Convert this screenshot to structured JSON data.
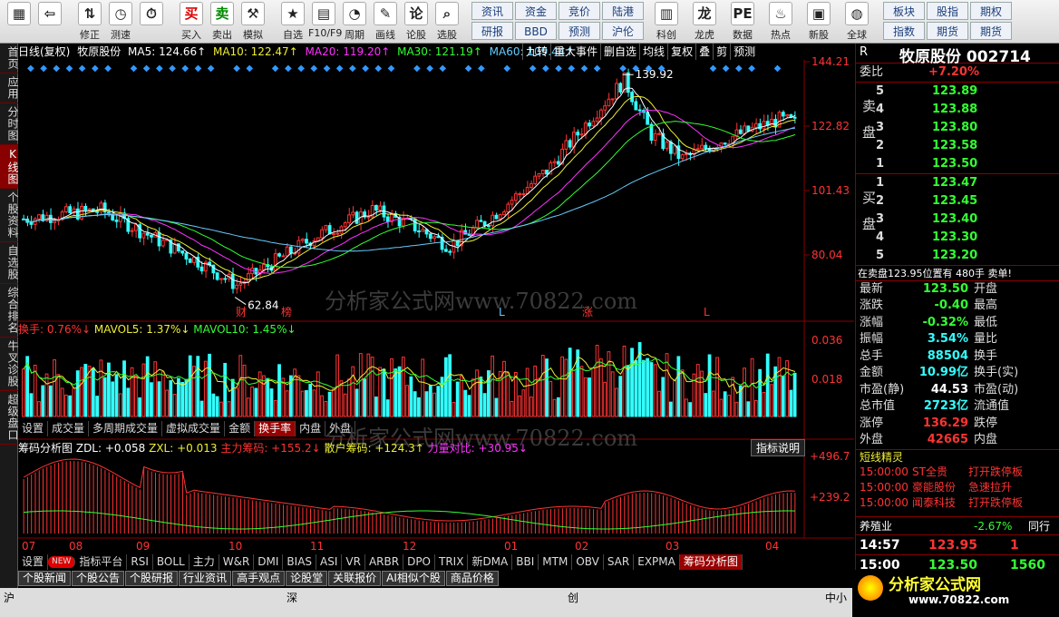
{
  "toolbar": {
    "buttons": [
      {
        "label": "",
        "icon": "grid-icon"
      },
      {
        "label": "",
        "icon": "back-arrow-icon"
      },
      {
        "label": "修正",
        "icon": "up-down-icon"
      },
      {
        "label": "测速",
        "icon": "timer-icon"
      },
      {
        "label": "",
        "icon": "clock-icon"
      },
      {
        "label": "买入",
        "icon": "buy-icon"
      },
      {
        "label": "卖出",
        "icon": "sell-icon"
      },
      {
        "label": "模拟",
        "icon": "gavel-icon"
      },
      {
        "label": "自选",
        "icon": "star-icon"
      },
      {
        "label": "F10/F9",
        "icon": "f10-icon"
      },
      {
        "label": "周期",
        "icon": "period-icon"
      },
      {
        "label": "画线",
        "icon": "pencil-icon"
      },
      {
        "label": "论股",
        "icon": "discuss-icon"
      },
      {
        "label": "选股",
        "icon": "magnifier-icon"
      }
    ],
    "pairs": [
      [
        "资讯",
        "研报"
      ],
      [
        "资金",
        "BBD"
      ],
      [
        "竞价",
        "预测"
      ],
      [
        "陆港",
        "沪伦"
      ]
    ],
    "buttons2": [
      {
        "label": "科创",
        "icon": "chart-icon"
      },
      {
        "label": "龙虎",
        "icon": "dragon-icon"
      },
      {
        "label": "数据",
        "icon": "pe-icon"
      },
      {
        "label": "热点",
        "icon": "fire-icon"
      },
      {
        "label": "新股",
        "icon": "calendar-icon"
      },
      {
        "label": "全球",
        "icon": "globe-icon"
      }
    ],
    "pairs2": [
      [
        "板块",
        "指数"
      ],
      [
        "股指",
        "期货"
      ],
      [
        "期权",
        "期货"
      ]
    ]
  },
  "leftnav": [
    "首页",
    "应用",
    "分时图",
    "K线图",
    "个股资料",
    "自选股",
    "综合排名",
    "牛叉诊股",
    "超级盘口"
  ],
  "leftnav_active": 3,
  "top_info": {
    "period": "日线(复权)",
    "name": "牧原股份",
    "ma5": "MA5: 124.66↑",
    "ma10": "MA10: 122.47↑",
    "ma20": "MA20: 119.20↑",
    "ma30": "MA30: 121.19↑",
    "ma60": "MA60: 109.44↑",
    "tabs": [
      "九转",
      "重大事件",
      "删自选",
      "均线",
      "复权",
      "叠",
      "剪",
      "预测"
    ]
  },
  "price_axis": [
    "144.21",
    "122.82",
    "101.43",
    "80.04"
  ],
  "price_markers": {
    "high": "139.92",
    "low": "62.84"
  },
  "event_markers": [
    "财",
    "榜",
    "L",
    "涨",
    "L"
  ],
  "volume_header": {
    "label": "换手: 0.76%↓",
    "mavol5": "MAVOL5: 1.37%↓",
    "mavol10": "MAVOL10: 1.45%↓"
  },
  "volume_axis": [
    "0.036",
    "0.018"
  ],
  "vol_tabs": [
    "设置",
    "成交量",
    "多周期成交量",
    "虚拟成交量",
    "金额",
    "换手率",
    "内盘",
    "外盘"
  ],
  "vol_tabs_active": 5,
  "chip_header": {
    "title": "筹码分析图",
    "zdl": "ZDL: +0.058",
    "zxl": "ZXL: +0.013",
    "main": "主力筹码: +155.2↓",
    "retail": "散户筹码: +124.3↑",
    "ratio": "力量对比: +30.95↓",
    "help": "指标说明"
  },
  "chip_axis": [
    "+496.7",
    "+239.2"
  ],
  "months": [
    "07",
    "08",
    "09",
    "10",
    "11",
    "12",
    "01",
    "02",
    "03",
    "04"
  ],
  "indicator_tabs": [
    "设置",
    "NEW",
    "指标平台",
    "RSI",
    "BOLL",
    "主力",
    "W&R",
    "DMI",
    "BIAS",
    "ASI",
    "VR",
    "ARBR",
    "DPO",
    "TRIX",
    "新DMA",
    "BBI",
    "MTM",
    "OBV",
    "SAR",
    "EXPMA",
    "筹码分析图"
  ],
  "indicator_active": 20,
  "news_tabs": [
    "个股新闻",
    "个股公告",
    "个股研报",
    "行业资讯",
    "高手观点",
    "论股堂",
    "关联报价",
    "AI相似个股",
    "商品价格"
  ],
  "watermark": "分析家公式网www.70822.com",
  "quote": {
    "r_label": "R",
    "title": "牧原股份 002714",
    "webi": {
      "label": "委比",
      "value": "+7.20%"
    },
    "sell_label": "卖盘",
    "buy_label": "买盘",
    "asks": [
      {
        "level": "5",
        "price": "123.89"
      },
      {
        "level": "4",
        "price": "123.88"
      },
      {
        "level": "3",
        "price": "123.80"
      },
      {
        "level": "2",
        "price": "123.58"
      },
      {
        "level": "1",
        "price": "123.50"
      }
    ],
    "bids": [
      {
        "level": "1",
        "price": "123.47"
      },
      {
        "level": "2",
        "price": "123.45"
      },
      {
        "level": "3",
        "price": "123.40"
      },
      {
        "level": "4",
        "price": "123.30"
      },
      {
        "level": "5",
        "price": "123.20"
      }
    ],
    "notice": "在卖盘123.95位置有 480手 卖单!",
    "stats": [
      {
        "l": "最新",
        "v": "123.50",
        "c": "green",
        "l2": "开盘",
        "v2": ""
      },
      {
        "l": "涨跌",
        "v": "-0.40",
        "c": "green",
        "l2": "最高",
        "v2": ""
      },
      {
        "l": "涨幅",
        "v": "-0.32%",
        "c": "green",
        "l2": "最低",
        "v2": ""
      },
      {
        "l": "振幅",
        "v": "3.54%",
        "c": "cyan",
        "l2": "量比",
        "v2": ""
      },
      {
        "l": "总手",
        "v": "88504",
        "c": "cyan",
        "l2": "换手",
        "v2": ""
      },
      {
        "l": "金额",
        "v": "10.99亿",
        "c": "cyan",
        "l2": "换手(实)",
        "v2": ""
      },
      {
        "l": "市盈(静)",
        "v": "44.53",
        "c": "white",
        "l2": "市盈(动)",
        "v2": ""
      },
      {
        "l": "总市值",
        "v": "2723亿",
        "c": "cyan",
        "l2": "流通值",
        "v2": ""
      },
      {
        "l": "涨停",
        "v": "136.29",
        "c": "red",
        "l2": "跌停",
        "v2": ""
      },
      {
        "l": "外盘",
        "v": "42665",
        "c": "red",
        "l2": "内盘",
        "v2": ""
      }
    ],
    "sprite_title": "短线精灵",
    "sprites": [
      {
        "t": "15:00:00",
        "n": "ST全贵",
        "e": "打开跌停板"
      },
      {
        "t": "15:00:00",
        "n": "豪能股份",
        "e": "急速拉升"
      },
      {
        "t": "15:00:00",
        "n": "闻泰科技",
        "e": "打开跌停板"
      }
    ],
    "industry": {
      "name": "养殖业",
      "pct": "-2.67%",
      "extra": "同行"
    },
    "ticks": [
      {
        "t": "14:57",
        "p": "123.95",
        "v": "1",
        "c": "red"
      },
      {
        "t": "15:00",
        "p": "123.50",
        "v": "1560",
        "c": "green"
      }
    ]
  },
  "statusbar": {
    "sh": "沪",
    "sz": "深",
    "cy": "创",
    "zx": "中小",
    "logo": "分析家公式网",
    "url": "www.70822.com"
  }
}
